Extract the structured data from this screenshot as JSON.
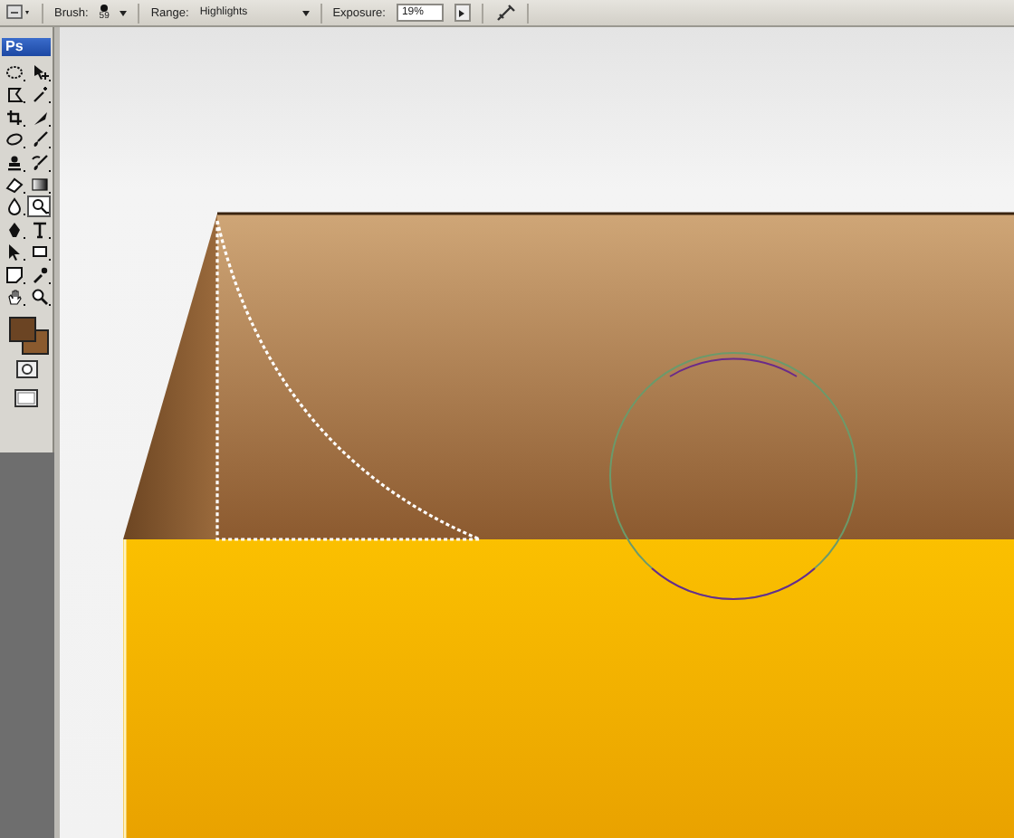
{
  "options_bar": {
    "brush_label": "Brush:",
    "brush_size": "59",
    "range_label": "Range:",
    "range_value": "Highlights",
    "exposure_label": "Exposure:",
    "exposure_value": "19%"
  },
  "toolbox": {
    "logo": "Ps",
    "tools": [
      {
        "kind": "marquee",
        "selected": false
      },
      {
        "kind": "move",
        "selected": false
      },
      {
        "kind": "lasso",
        "selected": false
      },
      {
        "kind": "wand",
        "selected": false
      },
      {
        "kind": "crop",
        "selected": false
      },
      {
        "kind": "slice",
        "selected": false
      },
      {
        "kind": "heal",
        "selected": false
      },
      {
        "kind": "brush",
        "selected": false
      },
      {
        "kind": "stamp",
        "selected": false
      },
      {
        "kind": "history",
        "selected": false
      },
      {
        "kind": "eraser",
        "selected": false
      },
      {
        "kind": "gradient",
        "selected": false
      },
      {
        "kind": "blur",
        "selected": false
      },
      {
        "kind": "dodge",
        "selected": true
      },
      {
        "kind": "pen",
        "selected": false
      },
      {
        "kind": "type",
        "selected": false
      },
      {
        "kind": "select",
        "selected": false
      },
      {
        "kind": "shape",
        "selected": false
      },
      {
        "kind": "notes",
        "selected": false
      },
      {
        "kind": "eyedropper",
        "selected": false
      },
      {
        "kind": "hand",
        "selected": false
      },
      {
        "kind": "zoom",
        "selected": false
      }
    ]
  }
}
